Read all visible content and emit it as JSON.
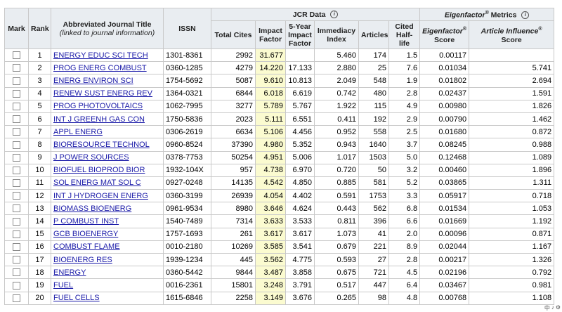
{
  "headers": {
    "mark": "Mark",
    "rank": "Rank",
    "title_main": "Abbreviated Journal Title",
    "title_sub": "(linked to journal information)",
    "issn": "ISSN",
    "jcr_group": "JCR Data",
    "eigen_group_main": "Eigenfactor",
    "eigen_group_sup": "®",
    "eigen_group_tail": " Metrics",
    "total_cites": "Total Cites",
    "impact_factor": "Impact Factor",
    "five_year_if": "5-Year Impact Factor",
    "immediacy": "Immediacy Index",
    "articles": "Articles",
    "half_life": "Cited Half-life",
    "ef_score_main": "Eigenfactor",
    "ef_score_sup": "®",
    "ef_score_tail": "Score",
    "ai_score_main": "Article Influence",
    "ai_score_sup": "®",
    "ai_score_tail": "Score",
    "info_glyph": "i"
  },
  "rows": [
    {
      "rank": "1",
      "title": "ENERGY EDUC SCI TECH",
      "issn": "1301-8361",
      "total_cites": "2992",
      "impact_factor": "31.677",
      "five_year_if": "",
      "immediacy": "5.460",
      "articles": "174",
      "half_life": "1.5",
      "ef_score": "0.00117",
      "ai_score": ""
    },
    {
      "rank": "2",
      "title": "PROG ENERG COMBUST",
      "issn": "0360-1285",
      "total_cites": "4279",
      "impact_factor": "14.220",
      "five_year_if": "17.133",
      "immediacy": "2.880",
      "articles": "25",
      "half_life": "7.6",
      "ef_score": "0.01034",
      "ai_score": "5.741"
    },
    {
      "rank": "3",
      "title": "ENERG ENVIRON SCI",
      "issn": "1754-5692",
      "total_cites": "5087",
      "impact_factor": "9.610",
      "five_year_if": "10.813",
      "immediacy": "2.049",
      "articles": "548",
      "half_life": "1.9",
      "ef_score": "0.01802",
      "ai_score": "2.694"
    },
    {
      "rank": "4",
      "title": "RENEW SUST ENERG REV",
      "issn": "1364-0321",
      "total_cites": "6844",
      "impact_factor": "6.018",
      "five_year_if": "6.619",
      "immediacy": "0.742",
      "articles": "480",
      "half_life": "2.8",
      "ef_score": "0.02437",
      "ai_score": "1.591"
    },
    {
      "rank": "5",
      "title": "PROG PHOTOVOLTAICS",
      "issn": "1062-7995",
      "total_cites": "3277",
      "impact_factor": "5.789",
      "five_year_if": "5.767",
      "immediacy": "1.922",
      "articles": "115",
      "half_life": "4.9",
      "ef_score": "0.00980",
      "ai_score": "1.826"
    },
    {
      "rank": "6",
      "title": "INT J GREENH GAS CON",
      "issn": "1750-5836",
      "total_cites": "2023",
      "impact_factor": "5.111",
      "five_year_if": "6.551",
      "immediacy": "0.411",
      "articles": "192",
      "half_life": "2.9",
      "ef_score": "0.00790",
      "ai_score": "1.462"
    },
    {
      "rank": "7",
      "title": "APPL ENERG",
      "issn": "0306-2619",
      "total_cites": "6634",
      "impact_factor": "5.106",
      "five_year_if": "4.456",
      "immediacy": "0.952",
      "articles": "558",
      "half_life": "2.5",
      "ef_score": "0.01680",
      "ai_score": "0.872"
    },
    {
      "rank": "8",
      "title": "BIORESOURCE TECHNOL",
      "issn": "0960-8524",
      "total_cites": "37390",
      "impact_factor": "4.980",
      "five_year_if": "5.352",
      "immediacy": "0.943",
      "articles": "1640",
      "half_life": "3.7",
      "ef_score": "0.08245",
      "ai_score": "0.988"
    },
    {
      "rank": "9",
      "title": "J POWER SOURCES",
      "issn": "0378-7753",
      "total_cites": "50254",
      "impact_factor": "4.951",
      "five_year_if": "5.006",
      "immediacy": "1.017",
      "articles": "1503",
      "half_life": "5.0",
      "ef_score": "0.12468",
      "ai_score": "1.089"
    },
    {
      "rank": "10",
      "title": "BIOFUEL BIOPROD BIOR",
      "issn": "1932-104X",
      "total_cites": "957",
      "impact_factor": "4.738",
      "five_year_if": "6.970",
      "immediacy": "0.720",
      "articles": "50",
      "half_life": "3.2",
      "ef_score": "0.00460",
      "ai_score": "1.896"
    },
    {
      "rank": "11",
      "title": "SOL ENERG MAT SOL C",
      "issn": "0927-0248",
      "total_cites": "14135",
      "impact_factor": "4.542",
      "five_year_if": "4.850",
      "immediacy": "0.885",
      "articles": "581",
      "half_life": "5.2",
      "ef_score": "0.03865",
      "ai_score": "1.311"
    },
    {
      "rank": "12",
      "title": "INT J HYDROGEN ENERG",
      "issn": "0360-3199",
      "total_cites": "26939",
      "impact_factor": "4.054",
      "five_year_if": "4.402",
      "immediacy": "0.591",
      "articles": "1753",
      "half_life": "3.3",
      "ef_score": "0.05917",
      "ai_score": "0.718"
    },
    {
      "rank": "13",
      "title": "BIOMASS BIOENERG",
      "issn": "0961-9534",
      "total_cites": "8980",
      "impact_factor": "3.646",
      "five_year_if": "4.624",
      "immediacy": "0.443",
      "articles": "562",
      "half_life": "6.8",
      "ef_score": "0.01534",
      "ai_score": "1.053"
    },
    {
      "rank": "14",
      "title": "P COMBUST INST",
      "issn": "1540-7489",
      "total_cites": "7314",
      "impact_factor": "3.633",
      "five_year_if": "3.533",
      "immediacy": "0.811",
      "articles": "396",
      "half_life": "6.6",
      "ef_score": "0.01669",
      "ai_score": "1.192"
    },
    {
      "rank": "15",
      "title": "GCB BIOENERGY",
      "issn": "1757-1693",
      "total_cites": "261",
      "impact_factor": "3.617",
      "five_year_if": "3.617",
      "immediacy": "1.073",
      "articles": "41",
      "half_life": "2.0",
      "ef_score": "0.00096",
      "ai_score": "0.871"
    },
    {
      "rank": "16",
      "title": "COMBUST FLAME",
      "issn": "0010-2180",
      "total_cites": "10269",
      "impact_factor": "3.585",
      "five_year_if": "3.541",
      "immediacy": "0.679",
      "articles": "221",
      "half_life": "8.9",
      "ef_score": "0.02044",
      "ai_score": "1.167"
    },
    {
      "rank": "17",
      "title": "BIOENERG RES",
      "issn": "1939-1234",
      "total_cites": "445",
      "impact_factor": "3.562",
      "five_year_if": "4.775",
      "immediacy": "0.593",
      "articles": "27",
      "half_life": "2.8",
      "ef_score": "0.00217",
      "ai_score": "1.326"
    },
    {
      "rank": "18",
      "title": "ENERGY",
      "issn": "0360-5442",
      "total_cites": "9844",
      "impact_factor": "3.487",
      "five_year_if": "3.858",
      "immediacy": "0.675",
      "articles": "721",
      "half_life": "4.5",
      "ef_score": "0.02196",
      "ai_score": "0.792"
    },
    {
      "rank": "19",
      "title": "FUEL",
      "issn": "0016-2361",
      "total_cites": "15801",
      "impact_factor": "3.248",
      "five_year_if": "3.791",
      "immediacy": "0.517",
      "articles": "447",
      "half_life": "6.4",
      "ef_score": "0.03467",
      "ai_score": "0.981"
    },
    {
      "rank": "20",
      "title": "FUEL CELLS",
      "issn": "1615-6846",
      "total_cites": "2258",
      "impact_factor": "3.149",
      "five_year_if": "3.676",
      "immediacy": "0.265",
      "articles": "98",
      "half_life": "4.8",
      "ef_score": "0.00768",
      "ai_score": "1.108"
    }
  ],
  "ime_bar": {
    "lang": "中",
    "glyph1": "♪",
    "glyph2": "⚙"
  },
  "colors": {
    "header_bg": "#e9edf1",
    "link": "#1a1aa8",
    "impact_highlight": "#fbfbd0",
    "border": "#c9c9c9"
  }
}
